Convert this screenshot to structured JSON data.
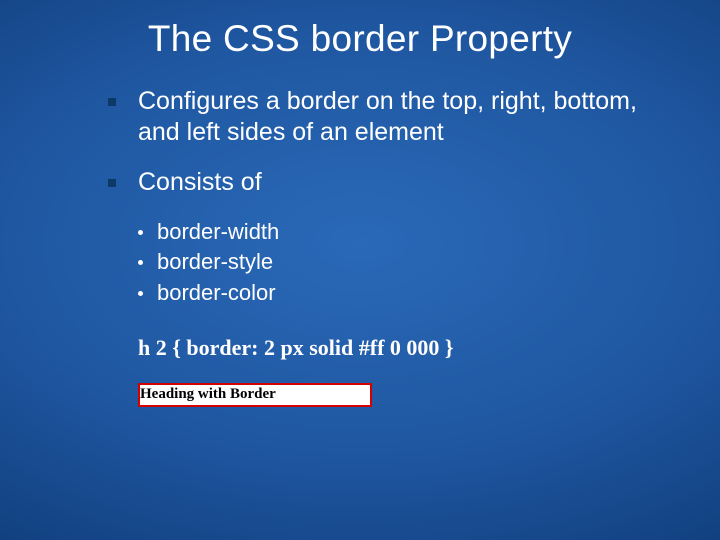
{
  "title": "The CSS border Property",
  "bullets": {
    "b1": "Configures a border on the top, right, bottom, and left sides of an element",
    "b2": "Consists of",
    "sub": [
      "border-width",
      "border-style",
      "border-color"
    ]
  },
  "code": "h 2 { border: 2 px solid #ff 0 000 }",
  "example_text": "Heading with Border"
}
